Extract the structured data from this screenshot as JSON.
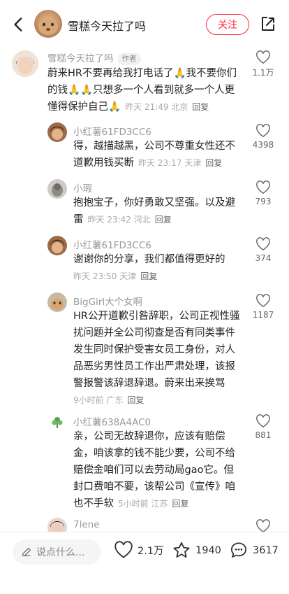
{
  "header": {
    "title": "雪糕今天拉了吗",
    "follow_label": "关注"
  },
  "comments": [
    {
      "name": "雪糕今天拉了吗",
      "tag": "作者",
      "text_lines": [
        "蔚来HR不要再给我打电话了🙏我不要你们",
        "的钱🙏🙏只想多一个人看到就多一个人更",
        "懂得保护自己🙏"
      ],
      "meta": "昨天 21:49 北京",
      "reply": "回复",
      "likes": "1.1万"
    },
    {
      "name": "小红薯61FD3CC6",
      "text_lines": [
        "得，越描越黑，公司不尊重女性还不",
        "道歉用钱买断"
      ],
      "meta": "昨天 23:17 天津",
      "reply": "回复",
      "likes": "4398"
    },
    {
      "name": "小瑕",
      "text_lines": [
        "抱抱宝子，你好勇敢又坚强。以及避",
        "雷"
      ],
      "meta": "昨天 23:42 河北",
      "reply": "回复",
      "likes": "793"
    },
    {
      "name": "小红薯61FD3CC6",
      "text_lines": [
        "谢谢你的分享，我们都值得更好的"
      ],
      "meta": "昨天 23:50 天津",
      "reply": "回复",
      "likes": "374"
    },
    {
      "name": "BigGirl大个女啊",
      "text_lines": [
        "HR公开道歉引咎辞职，公司正视性骚",
        "扰问题并全公司彻查是否有同类事件",
        "发生同时保护受害女员工身份，对人",
        "品恶劣男性员工作出严肃处理，该报",
        "警报警该辞退辞退。蔚来出来挨骂"
      ],
      "meta": "9小时前 广东",
      "reply": "回复",
      "likes": "1187"
    },
    {
      "name": "小红薯638A4AC0",
      "text_lines": [
        "亲，公司无故辞退你，应该有赔偿",
        "金，咱该拿的钱不能少要，公司不给",
        "赔偿金咱们可以去劳动局gao它。但",
        "封口费咱不要，该帮公司《宣传》咱",
        "也不手软"
      ],
      "meta": "5小时前 江苏",
      "reply": "回复",
      "likes": "881"
    },
    {
      "name": "7lene",
      "text_lines": [],
      "meta": "",
      "reply": "",
      "likes": ""
    }
  ],
  "bottom_bar": {
    "input_placeholder": "说点什么...",
    "likes": "2.1万",
    "stars": "1940",
    "comments": "3617"
  },
  "colors": {
    "accent": "#ff2442",
    "name_gray": "#999999",
    "meta_gray": "#aaaaaa"
  },
  "icons": [
    "back-arrow-icon",
    "share-icon",
    "heart-icon",
    "star-icon",
    "comment-bubble-icon",
    "pencil-icon"
  ]
}
